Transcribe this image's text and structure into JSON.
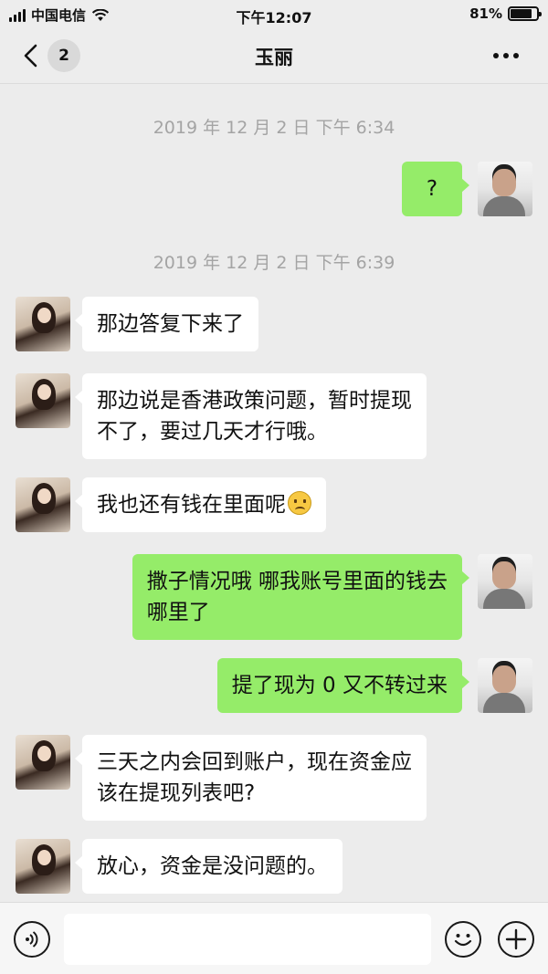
{
  "status_bar": {
    "carrier": "中国电信",
    "time": "下午12:07",
    "battery": "81%",
    "battery_level": 0.81
  },
  "nav": {
    "unread_count": "2",
    "title": "玉丽"
  },
  "messages": [
    {
      "type": "timestamp",
      "text": "2019 年 12 月 2 日  下午 6:34"
    },
    {
      "type": "message",
      "sender": "me",
      "text": "?"
    },
    {
      "type": "timestamp",
      "text": "2019 年 12 月 2 日  下午 6:39"
    },
    {
      "type": "message",
      "sender": "contact",
      "text": "那边答复下来了"
    },
    {
      "type": "message",
      "sender": "contact",
      "text": "那边说是香港政策问题，暂时提现\n不了，要过几天才行哦。"
    },
    {
      "type": "message",
      "sender": "contact",
      "text": "我也还有钱在里面呢",
      "emoji": "frowning-face"
    },
    {
      "type": "message",
      "sender": "me",
      "text": "撒子情况哦 哪我账号里面的钱去\n哪里了"
    },
    {
      "type": "message",
      "sender": "me",
      "text": "提了现为 0 又不转过来"
    },
    {
      "type": "message",
      "sender": "contact",
      "text": "三天之内会回到账户，现在资金应\n该在提现列表吧?"
    },
    {
      "type": "message",
      "sender": "contact",
      "text": "放心，资金是没问题的。"
    }
  ],
  "input_bar": {
    "placeholder": ""
  },
  "colors": {
    "background": "#ececec",
    "bubble_me": "#95ec69",
    "bubble_contact": "#ffffff",
    "timestamp": "#a4a4a4"
  }
}
